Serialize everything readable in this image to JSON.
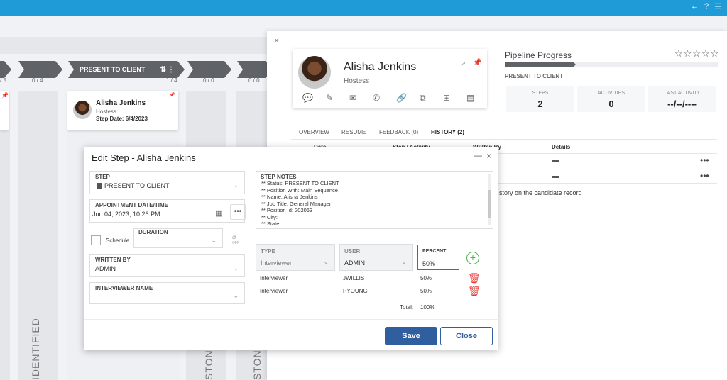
{
  "board": {
    "stages": [
      {
        "label": "",
        "count": "/ 5"
      },
      {
        "label": "",
        "count": "0 / 4"
      },
      {
        "label": "PRESENT TO CLIENT",
        "count": "1 / 4"
      },
      {
        "label": "",
        "count": "0 / 0"
      },
      {
        "label": "",
        "count": "0 / 0"
      }
    ],
    "vertical_labels": [
      "IDENTIFIED",
      "STONE",
      "STONE"
    ],
    "card": {
      "name": "Alisha Jenkins",
      "role": "Hostess",
      "step_date": "Step Date: 6/4/2023"
    }
  },
  "panel": {
    "name": "Alisha Jenkins",
    "role": "Hostess",
    "pipeline_title": "Pipeline Progress",
    "pipeline_stage": "PRESENT TO CLIENT",
    "stars": "☆☆☆☆☆",
    "stats": [
      {
        "label": "STEPS",
        "value": "2"
      },
      {
        "label": "ACTIVITIES",
        "value": "0"
      },
      {
        "label": "LAST ACTIVITY",
        "value": "--/--/----"
      }
    ],
    "tabs": [
      "OVERVIEW",
      "RESUME",
      "FEEDBACK (0)",
      "HISTORY (2)"
    ],
    "history": {
      "headers": [
        "Date",
        "Step / Activity",
        "Written By",
        "Details"
      ],
      "link": "story on the candidate record"
    }
  },
  "modal": {
    "title": "Edit Step - Alisha Jenkins",
    "step_label": "STEP",
    "step_value": "PRESENT TO CLIENT",
    "appointment_label": "APPOINTMENT DATE/TIME",
    "appointment_value": "Jun 04, 2023, 10:26 PM",
    "schedule_label": "Schedule",
    "duration_label": "DURATION",
    "off_label": "OFF",
    "written_by_label": "WRITTEN BY",
    "written_by_value": "ADMIN",
    "interviewer_label": "INTERVIEWER NAME",
    "notes_label": "STEP NOTES",
    "notes_lines": [
      "** Status: PRESENT TO CLIENT",
      "** Position With: Main Sequence",
      "** Name: Alisha Jenkins",
      "** Job Title: General Manager",
      "** Position Id: 202063",
      "** City:",
      "** State:"
    ],
    "type_label": "TYPE",
    "type_value": "Interviewer",
    "user_label": "USER",
    "user_value": "ADMIN",
    "percent_label": "PERCENT",
    "percent_value": "50%",
    "rows": [
      {
        "type": "Interviewer",
        "user": "JWILLIS",
        "percent": "50%"
      },
      {
        "type": "Interviewer",
        "user": "PYOUNG",
        "percent": "50%"
      }
    ],
    "total_label": "Total:",
    "total_value": "100%",
    "save_label": "Save",
    "close_label": "Close"
  }
}
